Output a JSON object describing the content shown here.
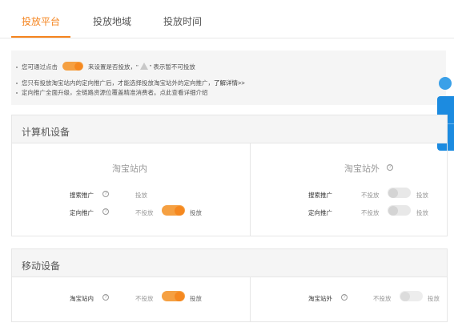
{
  "tabs": [
    {
      "label": "投放平台",
      "active": true
    },
    {
      "label": "投放地域",
      "active": false
    },
    {
      "label": "投放时间",
      "active": false
    }
  ],
  "notice": {
    "line1_before": "您可通过点击",
    "line1_after": "来设置是否投放，\"",
    "line1_end": "\" 表示暂不可投放",
    "line2": "您只有投放淘宝站内的定向推广后，才能选择投放淘宝站外的定向推广，",
    "line2_link": "了解详情>>",
    "line3": "定向推广全面升级，全链路资源位覆盖精准消费者。点此查看详细介绍"
  },
  "computer": {
    "title": "计算机设备",
    "inside": {
      "title": "淘宝站内",
      "rows": [
        {
          "label": "搜索推广",
          "off_label": "",
          "on_label": "投放",
          "state": "text-only"
        },
        {
          "label": "定向推广",
          "off_label": "不投放",
          "on_label": "投放",
          "state": "on"
        }
      ]
    },
    "outside": {
      "title": "淘宝站外",
      "rows": [
        {
          "label": "搜索推广",
          "off_label": "不投放",
          "on_label": "投放",
          "state": "off"
        },
        {
          "label": "定向推广",
          "off_label": "不投放",
          "on_label": "投放",
          "state": "off"
        }
      ]
    }
  },
  "mobile": {
    "title": "移动设备",
    "inside": {
      "label": "淘宝站内",
      "off_label": "不投放",
      "on_label": "投放",
      "state": "on"
    },
    "outside": {
      "label": "淘宝站外",
      "off_label": "不投放",
      "on_label": "投放",
      "state": "off"
    }
  },
  "help_glyph": "?",
  "colors": {
    "accent": "#f5841e",
    "side_widget": "#1c8be0"
  }
}
